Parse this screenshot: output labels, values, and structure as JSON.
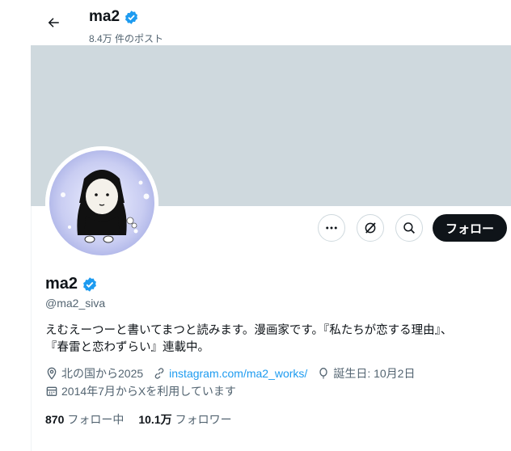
{
  "header": {
    "name": "ma2",
    "posts_count": "8.4万 件のポスト"
  },
  "actions": {
    "follow_label": "フォロー"
  },
  "profile": {
    "name": "ma2",
    "handle": "@ma2_siva",
    "bio_line1": "えむえーつーと書いてまつと読みます。漫画家です。『私たちが恋する理由』、",
    "bio_line2": "『春雷と恋わずらい』連載中。",
    "location": "北の国から2025",
    "link": "instagram.com/ma2_works/",
    "birthday": "誕生日: 10月2日",
    "joined": "2014年7月からXを利用しています"
  },
  "stats": {
    "following_count": "870",
    "following_label": "フォロー中",
    "followers_count": "10.1万",
    "followers_label": "フォロワー"
  },
  "colors": {
    "accent": "#1d9bf0",
    "banner": "#cfd9de",
    "follow_button": "#0f1419",
    "secondary_text": "#536471"
  },
  "icons": [
    "back-arrow-icon",
    "verified-badge-icon",
    "more-icon",
    "grok-icon",
    "search-icon",
    "location-icon",
    "link-icon",
    "balloon-icon",
    "calendar-icon"
  ]
}
